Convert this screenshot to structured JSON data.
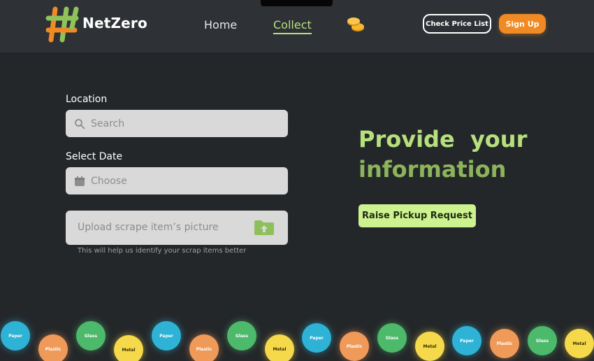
{
  "brand": {
    "name": "NetZero",
    "logo_icon": "hashtag-logo-icon"
  },
  "nav": {
    "home": "Home",
    "collect": "Collect",
    "coins_icon": "coins-icon",
    "active_color": "#b9e07f"
  },
  "header_actions": {
    "price_list": "Check Price List",
    "signup": "Sign Up",
    "signup_color": "#f08a24"
  },
  "form": {
    "location_label": "Location",
    "location_placeholder": "Search",
    "date_label": "Select Date",
    "date_placeholder": "Choose",
    "upload_placeholder": "Upload scrape item’s picture",
    "upload_hint": "This will help us identify your scrap items better"
  },
  "hero": {
    "title_line1": "Provide  your",
    "title_line2": "information",
    "cta": "Raise Pickup Request",
    "accent": "#b7e07d"
  },
  "bubbles": [
    {
      "label": "Paper",
      "kind": "paper"
    },
    {
      "label": "Plastic",
      "kind": "plastic"
    },
    {
      "label": "Glass",
      "kind": "glass"
    },
    {
      "label": "Metal",
      "kind": "metal"
    },
    {
      "label": "Paper",
      "kind": "paper"
    },
    {
      "label": "Plastic",
      "kind": "plastic"
    },
    {
      "label": "Glass",
      "kind": "glass"
    },
    {
      "label": "Metal",
      "kind": "metal"
    },
    {
      "label": "Paper",
      "kind": "paper"
    },
    {
      "label": "Plastic",
      "kind": "plastic"
    },
    {
      "label": "Glass",
      "kind": "glass"
    },
    {
      "label": "Metal",
      "kind": "metal"
    },
    {
      "label": "Paper",
      "kind": "paper"
    },
    {
      "label": "Plastic",
      "kind": "plastic"
    },
    {
      "label": "Glass",
      "kind": "glass"
    },
    {
      "label": "Metal",
      "kind": "metal"
    }
  ]
}
